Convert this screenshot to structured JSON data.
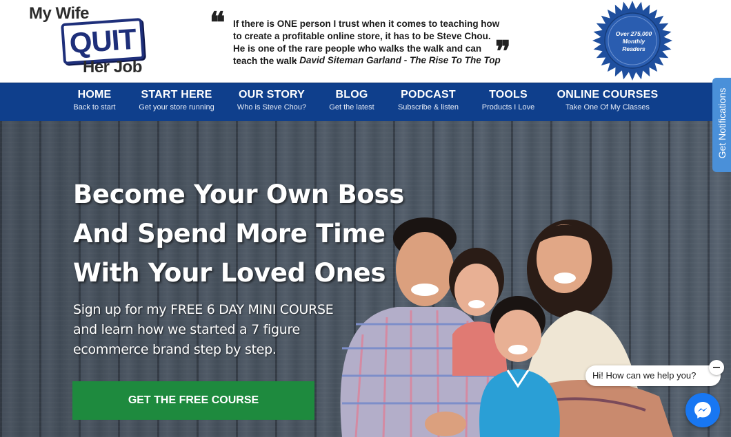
{
  "logo": {
    "line1": "My Wife",
    "line2": "QUIT",
    "line3": "Her Job"
  },
  "testimonial": {
    "quote": "If there is ONE person I trust when it comes to teaching how to create a profitable online store, it has to be Steve Chou. He is one of the rare people who walks the walk and can teach the walk",
    "author": "- David Siteman Garland - The Rise To The Top"
  },
  "badge": {
    "line1": "Over 275,000",
    "line2": "Monthly",
    "line3": "Readers",
    "color": "#1f4f9e"
  },
  "nav": {
    "items": [
      {
        "label": "HOME",
        "sub": "Back to start"
      },
      {
        "label": "START HERE",
        "sub": "Get your store running"
      },
      {
        "label": "OUR STORY",
        "sub": "Who is Steve Chou?"
      },
      {
        "label": "BLOG",
        "sub": "Get the latest"
      },
      {
        "label": "PODCAST",
        "sub": "Subscribe & listen"
      },
      {
        "label": "TOOLS",
        "sub": "Products I Love"
      },
      {
        "label": "ONLINE COURSES",
        "sub": "Take One Of My Classes"
      }
    ],
    "background": "#0f3f8c"
  },
  "hero": {
    "title_lines": [
      "Become Your Own Boss",
      "And Spend More Time",
      "With Your Loved Ones"
    ],
    "sub_lines": [
      "Sign up for my FREE 6 DAY MINI COURSE",
      "and learn how we started a 7 figure",
      "ecommerce brand step by step."
    ],
    "cta_label": "GET THE FREE COURSE",
    "cta_color": "#1e8a3e"
  },
  "notifications_tab": {
    "label": "Get Notifications"
  },
  "chat": {
    "greeting": "Hi! How can we help you?",
    "icon": "messenger-icon"
  }
}
